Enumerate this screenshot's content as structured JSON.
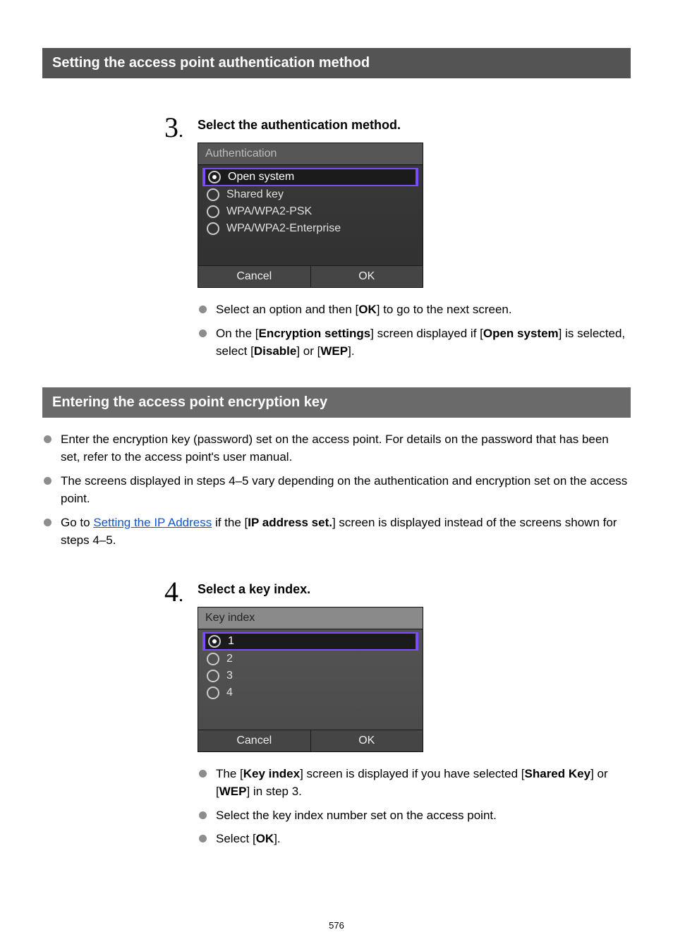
{
  "section_auth_header": "Setting the access point authentication method",
  "section_enc_header": "Entering the access point encryption key",
  "step3": {
    "number_display": "3",
    "title": "Select the authentication method.",
    "dialog_title": "Authentication",
    "options": [
      {
        "label": "Open system",
        "selected": true
      },
      {
        "label": "Shared key",
        "selected": false
      },
      {
        "label": "WPA/WPA2-PSK",
        "selected": false
      },
      {
        "label": "WPA/WPA2-Enterprise",
        "selected": false
      }
    ],
    "btn_cancel": "Cancel",
    "btn_ok": "OK",
    "bullet1_pre": "Select an option and then [",
    "bullet1_bold": "OK",
    "bullet1_post": "] to go to the next screen.",
    "bullet2_a": "On the [",
    "bullet2_b": "Encryption settings",
    "bullet2_c": "] screen displayed if [",
    "bullet2_d": "Open system",
    "bullet2_e": "] is selected, select [",
    "bullet2_f": "Disable",
    "bullet2_g": "] or [",
    "bullet2_h": "WEP",
    "bullet2_i": "]."
  },
  "enc_intro": {
    "b1": "Enter the encryption key (password) set on the access point. For details on the password that has been set, refer to the access point's user manual.",
    "b2": "The screens displayed in steps 4–5 vary depending on the authentication and encryption set on the access point.",
    "b3_a": "Go to ",
    "b3_link": "Setting the IP Address",
    "b3_b": " if the [",
    "b3_bold": "IP address set.",
    "b3_c": "] screen is displayed instead of the screens shown for steps 4–5."
  },
  "step4": {
    "number_display": "4",
    "title": "Select a key index.",
    "dialog_title": "Key index",
    "options": [
      {
        "label": "1",
        "selected": true
      },
      {
        "label": "2",
        "selected": false
      },
      {
        "label": "3",
        "selected": false
      },
      {
        "label": "4",
        "selected": false
      }
    ],
    "btn_cancel": "Cancel",
    "btn_ok": "OK",
    "bullet1_a": "The [",
    "bullet1_b": "Key index",
    "bullet1_c": "] screen is displayed if you have selected [",
    "bullet1_d": "Shared Key",
    "bullet1_e": "] or [",
    "bullet1_f": "WEP",
    "bullet1_g": "] in step 3.",
    "bullet2": "Select the key index number set on the access point.",
    "bullet3_a": "Select [",
    "bullet3_b": "OK",
    "bullet3_c": "]."
  },
  "page_number": "576"
}
